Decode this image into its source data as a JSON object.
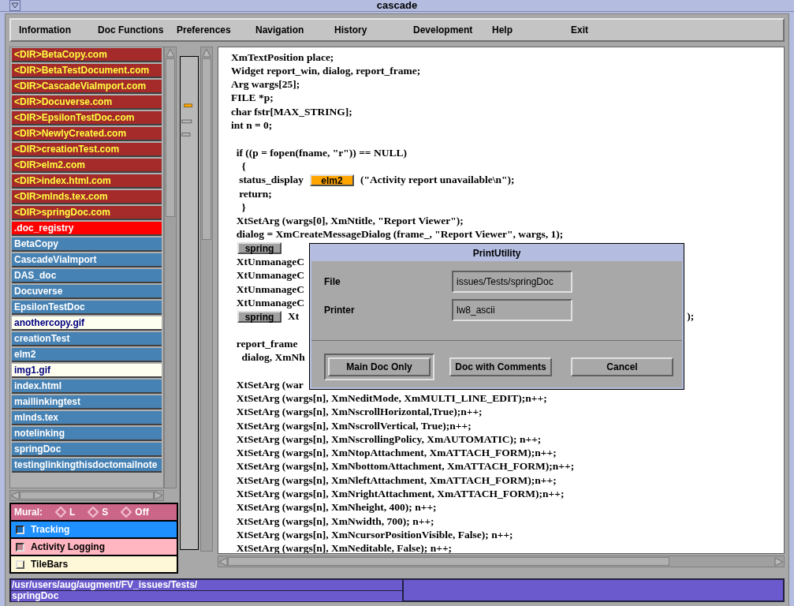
{
  "window": {
    "title": "cascade"
  },
  "menu": [
    "Information",
    "Doc Functions",
    "Preferences",
    "Navigation",
    "History",
    "Development",
    "Help",
    "Exit"
  ],
  "file_list": [
    {
      "kind": "dir",
      "label": "<DIR>BetaCopy.com",
      "selected": false
    },
    {
      "kind": "dir",
      "label": "<DIR>BetaTestDocument.com",
      "selected": false
    },
    {
      "kind": "dir",
      "label": "<DIR>CascadeViaImport.com",
      "selected": false
    },
    {
      "kind": "dir",
      "label": "<DIR>Docuverse.com",
      "selected": false
    },
    {
      "kind": "dir",
      "label": "<DIR>EpsilonTestDoc.com",
      "selected": false
    },
    {
      "kind": "dir",
      "label": "<DIR>NewlyCreated.com",
      "selected": false
    },
    {
      "kind": "dir",
      "label": "<DIR>creationTest.com",
      "selected": false
    },
    {
      "kind": "dir",
      "label": "<DIR>elm2.com",
      "selected": false
    },
    {
      "kind": "dir",
      "label": "<DIR>index.html.com",
      "selected": false
    },
    {
      "kind": "dir",
      "label": "<DIR>mlnds.tex.com",
      "selected": false
    },
    {
      "kind": "dir",
      "label": "<DIR>springDoc.com",
      "selected": false
    },
    {
      "kind": "doc",
      "label": ".doc_registry",
      "selected": true
    },
    {
      "kind": "doc",
      "label": "BetaCopy",
      "selected": false
    },
    {
      "kind": "doc",
      "label": "CascadeViaImport",
      "selected": false
    },
    {
      "kind": "doc",
      "label": "DAS_doc",
      "selected": false
    },
    {
      "kind": "doc",
      "label": "Docuverse",
      "selected": false
    },
    {
      "kind": "doc",
      "label": "EpsilonTestDoc",
      "selected": false
    },
    {
      "kind": "image",
      "label": "anothercopy.gif",
      "selected": false
    },
    {
      "kind": "doc",
      "label": "creationTest",
      "selected": false
    },
    {
      "kind": "doc",
      "label": "elm2",
      "selected": false
    },
    {
      "kind": "image",
      "label": "img1.gif",
      "selected": false
    },
    {
      "kind": "doc",
      "label": "index.html",
      "selected": false
    },
    {
      "kind": "doc",
      "label": "maillinkingtest",
      "selected": false
    },
    {
      "kind": "doc",
      "label": "mlnds.tex",
      "selected": false
    },
    {
      "kind": "doc",
      "label": "notelinking",
      "selected": false
    },
    {
      "kind": "doc",
      "label": "springDoc",
      "selected": false
    },
    {
      "kind": "doc",
      "label": "testinglinkingthisdoctomailnote",
      "selected": false
    }
  ],
  "mural": {
    "label": "Mural:",
    "options": [
      {
        "label": "L",
        "selected": false
      },
      {
        "label": "S",
        "selected": false
      },
      {
        "label": "Off",
        "selected": false
      }
    ]
  },
  "toggles": [
    {
      "label": "Tracking",
      "checked": true,
      "color": "#1e90ff"
    },
    {
      "label": "Activity Logging",
      "checked": true,
      "color": "#ffb6c1"
    },
    {
      "label": "TileBars",
      "checked": false,
      "color": "#fff8d8"
    }
  ],
  "code_lines": [
    [
      {
        "kind": "text",
        "text": "XmTextPosition place;"
      }
    ],
    [
      {
        "kind": "text",
        "text": "Widget report_win, dialog, report_frame;"
      }
    ],
    [
      {
        "kind": "text",
        "text": "Arg wargs[25];"
      }
    ],
    [
      {
        "kind": "text",
        "text": "FILE *p;"
      }
    ],
    [
      {
        "kind": "text",
        "text": "char fstr[MAX_STRING];"
      }
    ],
    [
      {
        "kind": "text",
        "text": "int n = 0;"
      }
    ],
    [
      {
        "kind": "blank"
      },
      {
        "kind": "text",
        "text": "  if ((p = fopen(fname, \"r\")) == NULL)"
      }
    ],
    [
      {
        "kind": "text",
        "text": "    {"
      }
    ],
    [
      {
        "kind": "text",
        "text": "   status_display"
      },
      {
        "kind": "button",
        "label": "elm2",
        "color": "#ffa500"
      },
      {
        "kind": "text",
        "text": "(\"Activity report unavailable\\n\");"
      }
    ],
    [
      {
        "kind": "text",
        "text": "   return;"
      }
    ],
    [
      {
        "kind": "text",
        "text": "    }"
      }
    ],
    [
      {
        "kind": "text",
        "text": "  XtSetArg (wargs[0], XmNtitle, \"Report Viewer\");"
      }
    ],
    [
      {
        "kind": "text",
        "text": "  dialog = XmCreateMessageDialog (frame_, \"Report Viewer\", wargs, 1);"
      }
    ],
    [
      {
        "kind": "button",
        "label": "spring",
        "color": "#a0a0a0"
      }
    ],
    [
      {
        "kind": "text",
        "text": "  XtUnmanageC"
      }
    ],
    [
      {
        "kind": "text",
        "text": "  XtUnmanageC"
      }
    ],
    [
      {
        "kind": "text",
        "text": "  XtUnmanageC"
      }
    ],
    [
      {
        "kind": "text",
        "text": "  XtUnmanageC"
      }
    ],
    [
      {
        "kind": "button",
        "label": "spring",
        "color": "#a0a0a0"
      },
      {
        "kind": "text",
        "text": "Xt"
      },
      {
        "kind": "tail",
        "text": ");"
      }
    ],
    [
      {
        "kind": "blank"
      },
      {
        "kind": "text",
        "text": "  report_frame"
      }
    ],
    [
      {
        "kind": "text",
        "text": "    dialog, XmNh"
      }
    ],
    [
      {
        "kind": "blank"
      },
      {
        "kind": "text",
        "text": "  XtSetArg (war"
      }
    ],
    [
      {
        "kind": "text",
        "text": "  XtSetArg (wargs[n], XmNeditMode, XmMULTI_LINE_EDIT);n++;"
      }
    ],
    [
      {
        "kind": "text",
        "text": "  XtSetArg (wargs[n], XmNscrollHorizontal,True);n++;"
      }
    ],
    [
      {
        "kind": "text",
        "text": "  XtSetArg (wargs[n], XmNscrollVertical, True);n++;"
      }
    ],
    [
      {
        "kind": "text",
        "text": "  XtSetArg (wargs[n], XmNscrollingPolicy, XmAUTOMATIC); n++;"
      }
    ],
    [
      {
        "kind": "text",
        "text": "  XtSetArg (wargs[n], XmNtopAttachment, XmATTACH_FORM);n++;"
      }
    ],
    [
      {
        "kind": "text",
        "text": "  XtSetArg (wargs[n], XmNbottomAttachment, XmATTACH_FORM);n++;"
      }
    ],
    [
      {
        "kind": "text",
        "text": "  XtSetArg (wargs[n], XmNleftAttachment, XmATTACH_FORM);n++;"
      }
    ],
    [
      {
        "kind": "text",
        "text": "  XtSetArg (wargs[n], XmNrightAttachment, XmATTACH_FORM);n++;"
      }
    ],
    [
      {
        "kind": "text",
        "text": "  XtSetArg (wargs[n], XmNheight, 400); n++;"
      }
    ],
    [
      {
        "kind": "text",
        "text": "  XtSetArg (wargs[n], XmNwidth, 700); n++;"
      }
    ],
    [
      {
        "kind": "text",
        "text": "  XtSetArg (wargs[n], XmNcursorPositionVisible, False); n++;"
      }
    ],
    [
      {
        "kind": "text",
        "text": "  XtSetArg (wargs[n], XmNeditable, False); n++;"
      }
    ]
  ],
  "dialog": {
    "title": "PrintUtility",
    "fields": [
      {
        "label": "File",
        "value": "issues/Tests/springDoc"
      },
      {
        "label": "Printer",
        "value": "lw8_ascii"
      }
    ],
    "buttons": [
      {
        "label": "Main Doc Only",
        "default": true
      },
      {
        "label": "Doc with Comments",
        "default": false
      },
      {
        "label": "Cancel",
        "default": false
      }
    ]
  },
  "status_bar": {
    "path_lines": [
      "/usr/users/aug/augment/FV_issues/Tests/",
      "springDoc"
    ]
  }
}
